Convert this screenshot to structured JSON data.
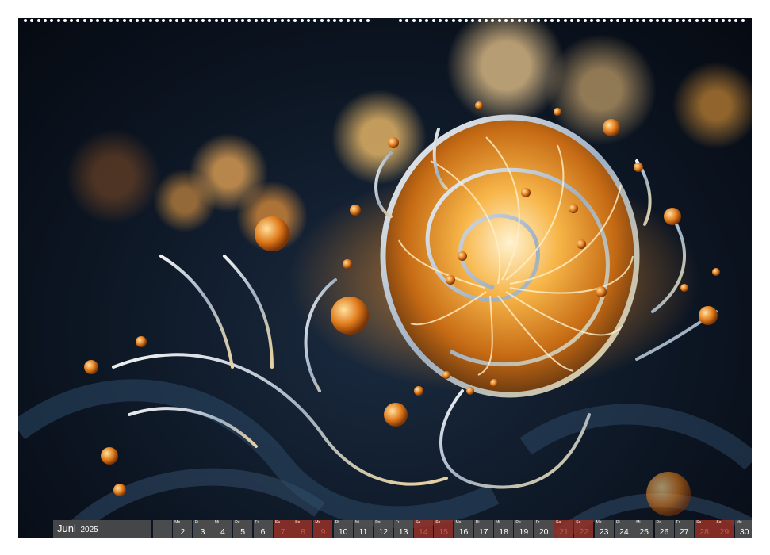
{
  "calendar": {
    "month": "Juni",
    "year": "2025",
    "days": [
      {
        "wd": "",
        "num": "",
        "type": "blank"
      },
      {
        "wd": "Mo",
        "num": "2",
        "type": "wk"
      },
      {
        "wd": "Di",
        "num": "3",
        "type": "wk"
      },
      {
        "wd": "Mi",
        "num": "4",
        "type": "wk"
      },
      {
        "wd": "Do",
        "num": "5",
        "type": "wk"
      },
      {
        "wd": "Fr",
        "num": "6",
        "type": "wk"
      },
      {
        "wd": "Sa",
        "num": "7",
        "type": "we"
      },
      {
        "wd": "So",
        "num": "8",
        "type": "we"
      },
      {
        "wd": "Mo",
        "num": "9",
        "type": "we"
      },
      {
        "wd": "Di",
        "num": "10",
        "type": "wk"
      },
      {
        "wd": "Mi",
        "num": "11",
        "type": "wk"
      },
      {
        "wd": "Do",
        "num": "12",
        "type": "wk"
      },
      {
        "wd": "Fr",
        "num": "13",
        "type": "wk"
      },
      {
        "wd": "Sa",
        "num": "14",
        "type": "we"
      },
      {
        "wd": "So",
        "num": "15",
        "type": "we"
      },
      {
        "wd": "Mo",
        "num": "16",
        "type": "wk"
      },
      {
        "wd": "Di",
        "num": "17",
        "type": "wk"
      },
      {
        "wd": "Mi",
        "num": "18",
        "type": "wk"
      },
      {
        "wd": "Do",
        "num": "19",
        "type": "wk"
      },
      {
        "wd": "Fr",
        "num": "20",
        "type": "wk"
      },
      {
        "wd": "Sa",
        "num": "21",
        "type": "we"
      },
      {
        "wd": "So",
        "num": "22",
        "type": "we"
      },
      {
        "wd": "Mo",
        "num": "23",
        "type": "wk"
      },
      {
        "wd": "Di",
        "num": "24",
        "type": "wk"
      },
      {
        "wd": "Mi",
        "num": "25",
        "type": "wk"
      },
      {
        "wd": "Do",
        "num": "26",
        "type": "wk"
      },
      {
        "wd": "Fr",
        "num": "27",
        "type": "wk"
      },
      {
        "wd": "Sa",
        "num": "28",
        "type": "we"
      },
      {
        "wd": "So",
        "num": "29",
        "type": "we"
      },
      {
        "wd": "Mo",
        "num": "30",
        "type": "wk"
      }
    ]
  },
  "colors": {
    "weekend": "#c8584a",
    "bar": "#505050",
    "accent_gold": "#f2a23c"
  },
  "photo": {
    "subject": "fractal-golden-spiral-shell"
  }
}
